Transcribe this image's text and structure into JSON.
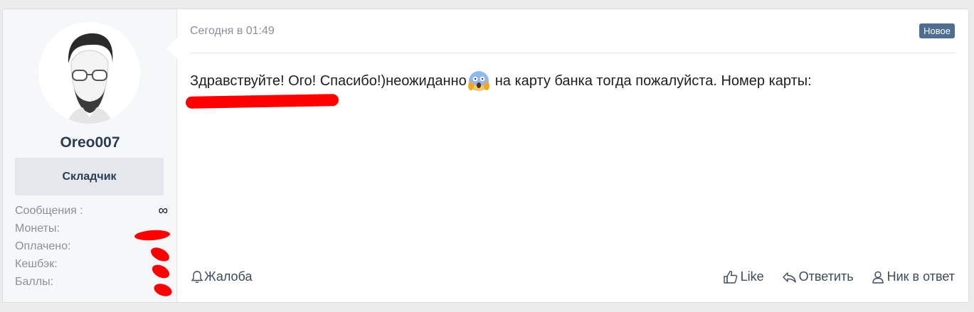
{
  "post": {
    "author": {
      "username": "Oreo007",
      "role": "Складчик",
      "stats": [
        {
          "label": "Сообщения :",
          "value": "∞"
        },
        {
          "label": "Монеты:",
          "value": ""
        },
        {
          "label": "Оплачено:",
          "value": ""
        },
        {
          "label": "Кешбэк:",
          "value": ""
        },
        {
          "label": "Баллы:",
          "value": ""
        }
      ]
    },
    "date": "Сегодня в 01:49",
    "badge": "Новое",
    "message": {
      "before_emoji": "Здравствуйте! Ого! Спасибо!)неожиданно",
      "emoji": "face-screaming-in-fear",
      "after_emoji": "на карту банка тогда пожалуйста. Номер карты:"
    },
    "actions": {
      "report": "Жалоба",
      "like": "Like",
      "reply": "Ответить",
      "mention": "Ник в ответ"
    }
  },
  "colors": {
    "accent": "#4f6d8f",
    "username": "#2b3b52",
    "redaction": "#ff0000"
  }
}
